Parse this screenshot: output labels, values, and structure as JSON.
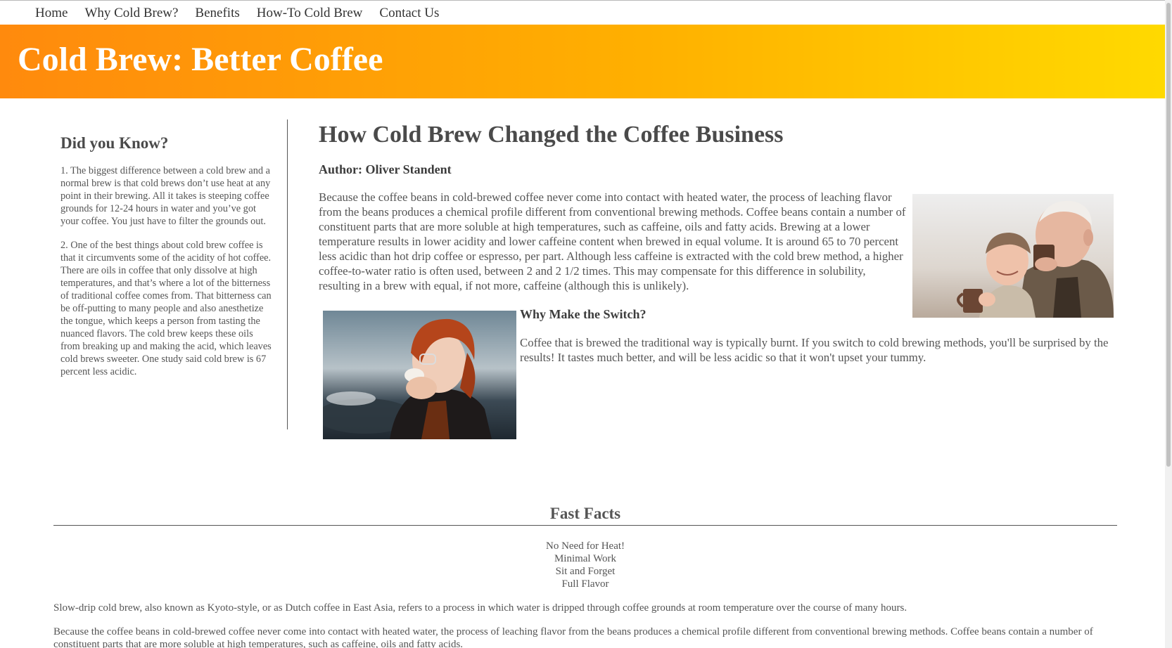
{
  "nav": {
    "items": [
      "Home",
      "Why Cold Brew?",
      "Benefits",
      "How-To Cold Brew",
      "Contact Us"
    ]
  },
  "banner": {
    "title": "Cold Brew: Better Coffee"
  },
  "sidebar": {
    "heading": "Did you Know?",
    "facts": [
      "1. The biggest difference between a cold brew and a normal brew is that cold brews don’t use heat at any point in their brewing. All it takes is steeping coffee grounds for 12-24 hours in water and you’ve got your coffee. You just have to filter the grounds out.",
      "2. One of the best things about cold brew coffee is that it circumvents some of the acidity of hot coffee. There are oils in coffee that only dissolve at high temperatures, and that’s where a lot of the bitterness of traditional coffee comes from. That bitterness can be off-putting to many people and also anesthetize the tongue, which keeps a person from tasting the nuanced flavors. The cold brew keeps these oils from breaking up and making the acid, which leaves cold brews sweeter. One study said cold brew is 67 percent less acidic."
    ]
  },
  "article": {
    "title": "How Cold Brew Changed the Coffee Business",
    "author": "Author: Oliver Standent",
    "intro": "Because the coffee beans in cold-brewed coffee never come into contact with heated water, the process of leaching flavor from the beans produces a chemical profile different from conventional brewing methods. Coffee beans contain a number of constituent parts that are more soluble at high temperatures, such as caffeine, oils and fatty acids. Brewing at a lower temperature results in lower acidity and lower caffeine content when brewed in equal volume. It is around 65 to 70 percent less acidic than hot drip coffee or espresso, per part. Although less caffeine is extracted with the cold brew method, a higher coffee-to-water ratio is often used, between 2 and 2 1/2 times. This may compensate for this difference in solubility, resulting in a brew with equal, if not more, caffeine (although this is unlikely).",
    "switch_heading": "Why Make the Switch?",
    "switch_text": "Coffee that is brewed the traditional way is typically burnt. If you switch to cold brewing methods, you'll be surprised by the results! It tastes much better, and will be less acidic so that it won't upset your tummy."
  },
  "fast_facts": {
    "heading": "Fast Facts",
    "items": [
      "No Need for Heat!",
      "Minimal Work",
      "Sit and Forget",
      "Full Flavor"
    ],
    "paragraphs": [
      "Slow-drip cold brew, also known as Kyoto-style, or as Dutch coffee in East Asia, refers to a process in which water is dripped through coffee grounds at room temperature over the course of many hours.",
      "Because the coffee beans in cold-brewed coffee never come into contact with heated water, the process of leaching flavor from the beans produces a chemical profile different from conventional brewing methods. Coffee beans contain a number of constituent parts that are more soluble at high temperatures, such as caffeine, oils and fatty acids."
    ]
  },
  "colors": {
    "banner_start": "#ff8a0d",
    "banner_end": "#ffda00",
    "text": "#555555"
  }
}
